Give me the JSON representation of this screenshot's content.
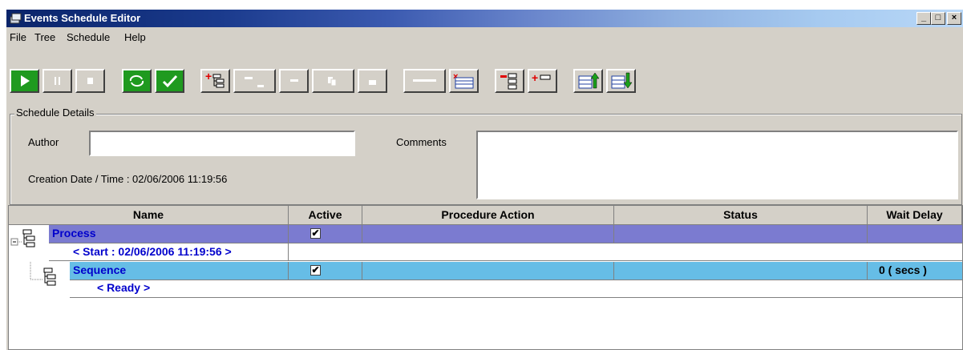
{
  "window": {
    "title": "Events Schedule Editor"
  },
  "titlebar_buttons": {
    "minimize": "_",
    "maximize": "□",
    "close": "×"
  },
  "menu": [
    "File",
    "Tree",
    "Schedule",
    "Help"
  ],
  "toolbar": {
    "buttons": [
      "play-icon",
      "pause-icon",
      "stop-icon",
      "cycle-icon",
      "check-icon",
      "add-process-icon",
      "collapse-icon",
      "remove-icon",
      "copy-icon",
      "paste-icon",
      "line-icon",
      "delete-list-icon",
      "remove-sequence-icon",
      "add-sequence-icon",
      "move-up-icon",
      "move-down-icon"
    ]
  },
  "schedule_details": {
    "group_label": "Schedule Details",
    "author_label": "Author",
    "author_value": "",
    "comments_label": "Comments",
    "comments_value": "",
    "creation_label": "Creation Date / Time :  02/06/2006 11:19:56"
  },
  "grid": {
    "headers": [
      "Name",
      "Active",
      "Procedure Action",
      "Status",
      "Wait Delay"
    ],
    "rows": [
      {
        "name": "Process",
        "active": true,
        "procedure_action": "",
        "status": "",
        "wait_delay": "",
        "sub": "< Start : 02/06/2006 11:19:56 >"
      },
      {
        "name": "Sequence",
        "active": true,
        "procedure_action": "",
        "status": "",
        "wait_delay": "0 ( secs )",
        "sub": "< Ready >"
      }
    ],
    "checkmark": "✔"
  },
  "colors": {
    "process_row": "#7b7bd0",
    "sequence_row": "#66bde6",
    "text_blue": "#0000cc",
    "green_button": "#1f9a1f"
  }
}
